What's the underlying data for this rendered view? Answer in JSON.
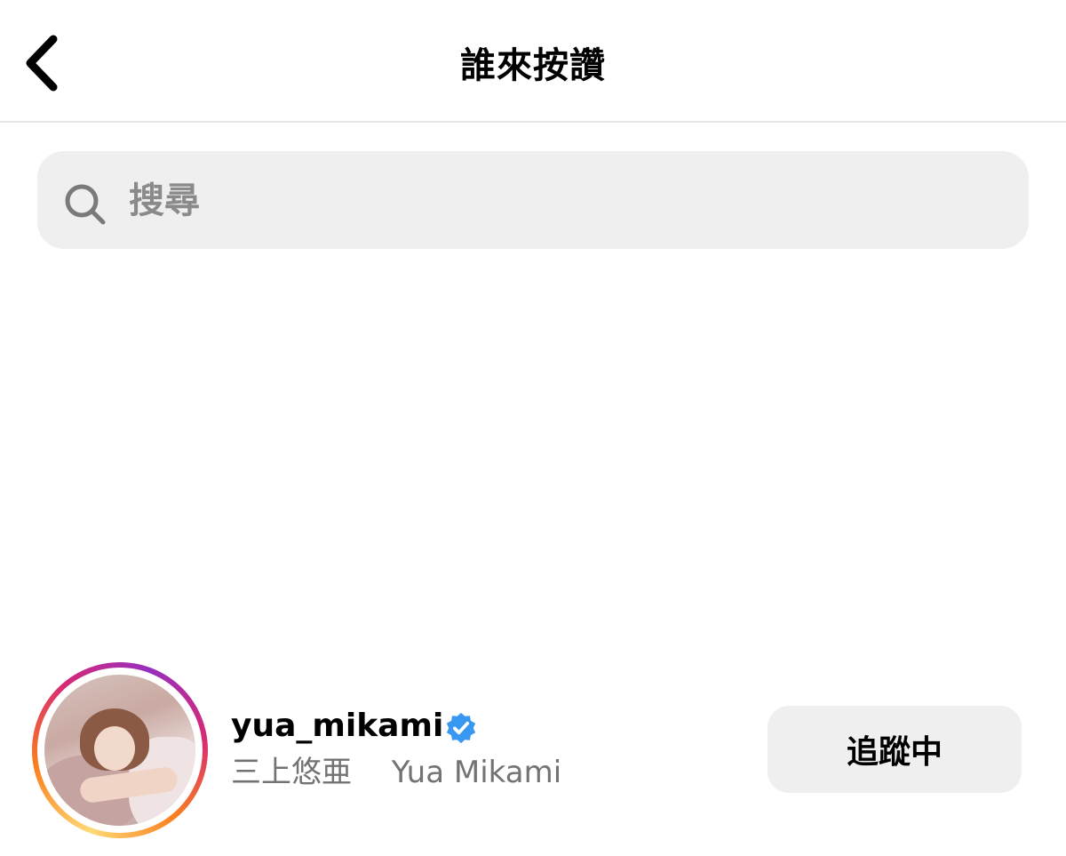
{
  "header": {
    "title": "誰來按讚",
    "back_icon": "chevron-left-icon"
  },
  "search": {
    "placeholder": "搜尋",
    "value": "",
    "icon": "search-icon"
  },
  "likes": [
    {
      "username": "yua_mikami",
      "verified": true,
      "full_name": "三上悠亜　 Yua Mikami",
      "follow_label": "追蹤中",
      "has_story_ring": true
    }
  ],
  "colors": {
    "verified_blue": "#3897f0",
    "secondary_text": "#737373",
    "search_bg": "#efefef",
    "button_bg": "#efefef"
  }
}
